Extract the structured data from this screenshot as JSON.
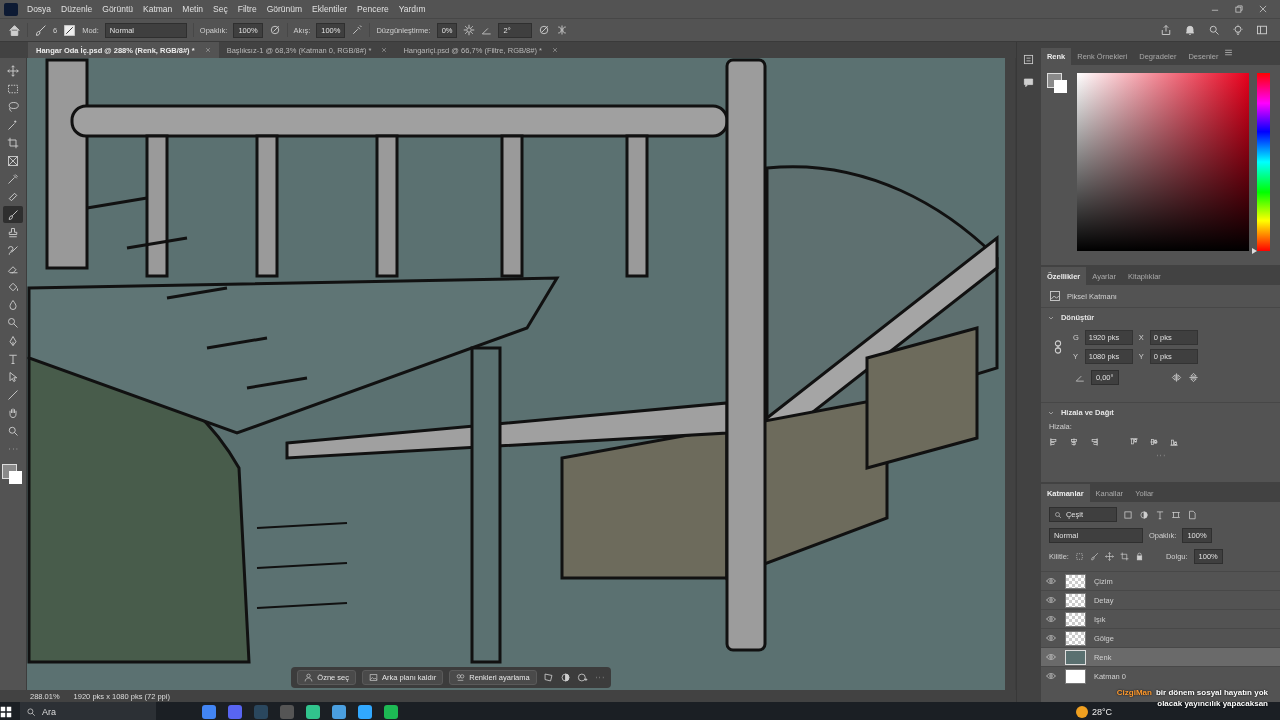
{
  "menu_bar": {
    "items": [
      "Dosya",
      "Düzenle",
      "Görüntü",
      "Katman",
      "Metin",
      "Seç",
      "Filtre",
      "Görünüm",
      "Eklentiler",
      "Pencere",
      "Yardım"
    ]
  },
  "options_bar": {
    "brush_size": "6",
    "mode_label": "Mod:",
    "mode": "Normal",
    "opacity_label": "Opaklık:",
    "opacity": "100%",
    "flow_label": "Akış:",
    "flow": "100%",
    "smoothing_label": "Düzgünleştirme:",
    "smoothing": "0%",
    "angle": "2°"
  },
  "document_tabs": [
    {
      "label": "Hangar Oda İç.psd @ 288% (Renk, RGB/8#) *",
      "selected": true
    },
    {
      "label": "Başlıksız-1 @ 68,3% (Katman 0, RGB/8#) *",
      "selected": false
    },
    {
      "label": "Hangariçi.psd @ 66,7% (Filtre, RGB/8#) *",
      "selected": false
    }
  ],
  "toolbar": {
    "tools": [
      {
        "kind": "move",
        "selected": false
      },
      {
        "kind": "marquee",
        "selected": false
      },
      {
        "kind": "lasso",
        "selected": false
      },
      {
        "kind": "wand",
        "selected": false
      },
      {
        "kind": "crop",
        "selected": false
      },
      {
        "kind": "frame",
        "selected": false
      },
      {
        "kind": "eyedropper",
        "selected": false
      },
      {
        "kind": "healing",
        "selected": false
      },
      {
        "kind": "brush",
        "selected": true
      },
      {
        "kind": "stamp",
        "selected": false
      },
      {
        "kind": "history",
        "selected": false
      },
      {
        "kind": "eraser",
        "selected": false
      },
      {
        "kind": "bucket",
        "selected": false
      },
      {
        "kind": "blur",
        "selected": false
      },
      {
        "kind": "dodge",
        "selected": false
      },
      {
        "kind": "pen",
        "selected": false
      },
      {
        "kind": "type",
        "selected": false
      },
      {
        "kind": "select",
        "selected": false
      },
      {
        "kind": "line",
        "selected": false
      },
      {
        "kind": "hand",
        "selected": false
      },
      {
        "kind": "zoom",
        "selected": false
      },
      {
        "kind": "more",
        "selected": false
      }
    ]
  },
  "color_panel": {
    "hue_slider": {
      "level": 0
    },
    "tabs": [
      {
        "label": "Renk",
        "selected": true
      },
      {
        "label": "Renk Örnekleri",
        "selected": false
      },
      {
        "label": "Degradeler",
        "selected": false
      },
      {
        "label": "Desenler",
        "selected": false
      }
    ]
  },
  "properties_panel": {
    "tabs": [
      {
        "label": "Özellikler",
        "selected": true
      },
      {
        "label": "Ayarlar",
        "selected": false
      },
      {
        "label": "Kitaplıklar",
        "selected": false
      }
    ],
    "layer_type": "Piksel Katmanı",
    "transform": {
      "title": "Dönüştür",
      "expanded": true,
      "fields": [
        {
          "label": "G",
          "value": "1920 pks"
        },
        {
          "label": "X",
          "value": "0 pks"
        },
        {
          "label": "Y",
          "value": "1080 pks"
        },
        {
          "label": "Y",
          "value": "0 pks"
        }
      ],
      "angle": "0,00°"
    },
    "align": {
      "title": "Hizala ve Dağıt",
      "expanded": true,
      "label": "Hizala:"
    }
  },
  "layers_panel": {
    "tabs": [
      {
        "label": "Katmanlar",
        "selected": true
      },
      {
        "label": "Kanallar",
        "selected": false
      },
      {
        "label": "Yollar",
        "selected": false
      }
    ],
    "filter": "Çeşit",
    "blend_mode": "Normal",
    "opacity_label": "Opaklık:",
    "opacity": "100%",
    "lock_label": "Kilitle:",
    "fill_label": "Dolgu:",
    "fill": "100%",
    "layers": [
      {
        "name": "Çizim",
        "visible": true,
        "selected": false,
        "kind": "transparent"
      },
      {
        "name": "Detay",
        "visible": true,
        "selected": false,
        "kind": "transparent"
      },
      {
        "name": "Işık",
        "visible": true,
        "selected": false,
        "kind": "transparent"
      },
      {
        "name": "Gölge",
        "visible": true,
        "selected": false,
        "kind": "transparent"
      },
      {
        "name": "Renk",
        "visible": true,
        "selected": true,
        "kind": "color"
      },
      {
        "name": "Katman 0",
        "visible": true,
        "selected": false,
        "kind": "white"
      }
    ]
  },
  "contextual_task_bar": {
    "buttons": [
      "Özne seç",
      "Arka planı kaldır",
      "Renkleri ayarlama"
    ]
  },
  "status_bar": {
    "zoom": "288.01%",
    "document_info": "1920 pks x 1080 pks (72 ppi)"
  },
  "taskbar": {
    "search": "Ara",
    "temperature": "28°C"
  },
  "chat_overlay": {
    "user": "CizgiMan",
    "message": "bir dönem sosyal hayatın yok olacak yayıncılık yapacaksan"
  }
}
